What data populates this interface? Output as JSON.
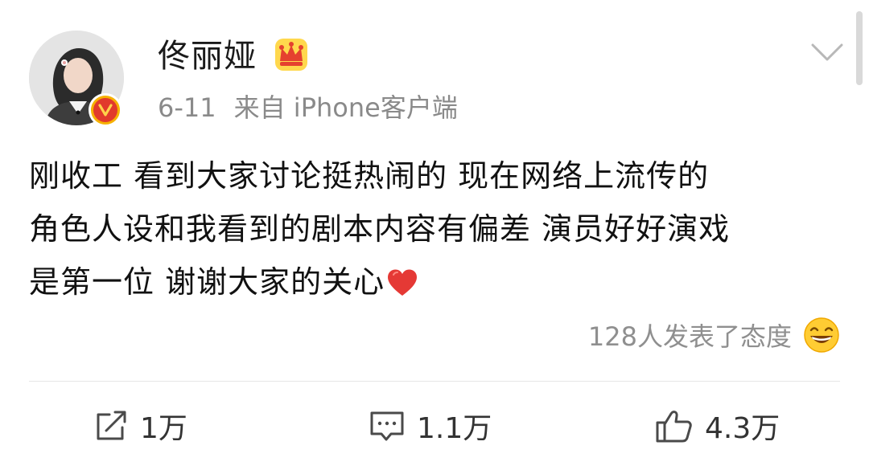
{
  "post": {
    "author_name": "佟丽娅",
    "date": "6-11",
    "source": "来自 iPhone客户端",
    "content_lines": [
      "刚收工 看到大家讨论挺热闹的 现在网络上流传的",
      "角色人设和我看到的剧本内容有偏差 演员好好演戏",
      "是第一位 谢谢大家的关心"
    ],
    "reactions_text": "128人发表了态度",
    "actions": {
      "repost_count": "1万",
      "comment_count": "1.1万",
      "like_count": "4.3万"
    }
  },
  "icons": {
    "verified": "verified-v-icon",
    "crown": "crown-icon",
    "menu": "chevron-down-icon",
    "heart": "heart-icon",
    "laugh": "laugh-emoji-icon",
    "repost": "repost-icon",
    "comment": "comment-icon",
    "like": "like-icon"
  },
  "colors": {
    "accent_red": "#e13a2c",
    "badge_gold": "#f6b100",
    "meta_gray": "#8a8a8a",
    "heart_red": "#e53935"
  }
}
